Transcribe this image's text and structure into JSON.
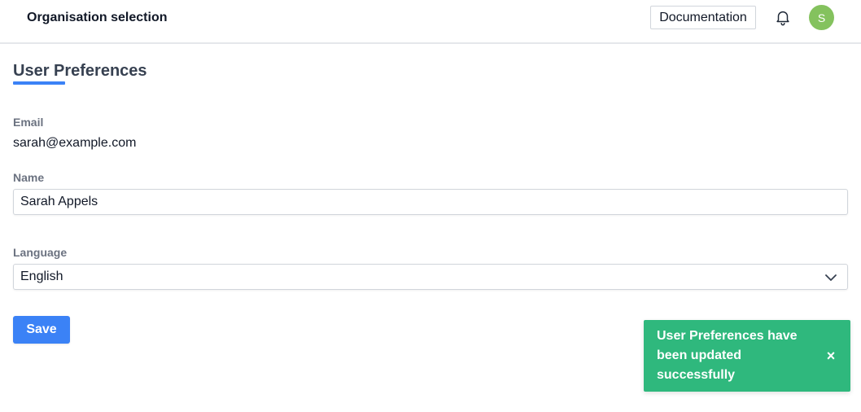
{
  "header": {
    "org_selector": "Organisation selection",
    "documentation_label": "Documentation",
    "notifications_icon": "bell-icon",
    "avatar_initial": "S",
    "avatar_color": "#84c25e"
  },
  "page": {
    "title": "User Preferences",
    "accent_color": "#3b82f6"
  },
  "form": {
    "email": {
      "label": "Email",
      "value": "sarah@example.com"
    },
    "name": {
      "label": "Name",
      "value": "Sarah Appels"
    },
    "language": {
      "label": "Language",
      "selected": "English",
      "icon": "chevron-down-icon"
    },
    "save_label": "Save"
  },
  "toast": {
    "message": "User Preferences have been updated successfully",
    "close_glyph": "×",
    "background_color": "#2fb87d"
  }
}
